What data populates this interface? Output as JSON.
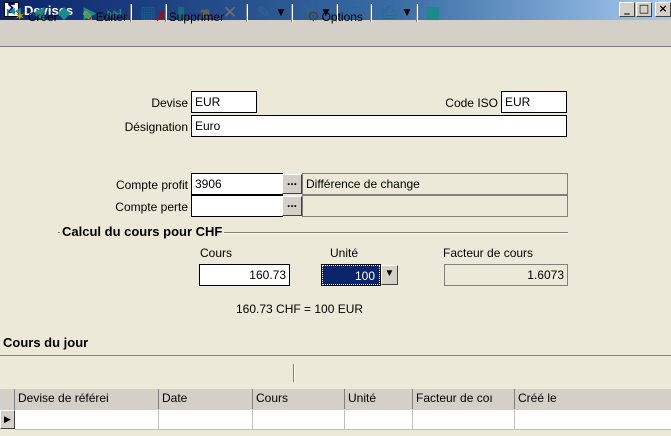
{
  "window": {
    "title": "Devises",
    "icon": "sigma-icon",
    "title_bar_color": "#0a246a"
  },
  "toolbar": {
    "icons": [
      "first-record-icon",
      "prev-record-icon",
      "diamond-icon",
      "next-record-icon",
      "last-record-icon",
      "grid-view-icon",
      "new-doc-icon",
      "save-icon",
      "delete-icon",
      "pencil-icon",
      "filter-icon",
      "cursor-icon",
      "print-icon",
      "exit-icon"
    ]
  },
  "form": {
    "devise_label": "Devise",
    "devise_value": "EUR",
    "code_iso_label": "Code ISO",
    "code_iso_value": "EUR",
    "designation_label": "Désignation",
    "designation_value": "Euro",
    "compte_profit_label": "Compte profit",
    "compte_profit_value": "3906",
    "compte_profit_desc": "Différence de change",
    "compte_perte_label": "Compte perte",
    "compte_perte_value": "",
    "ellipsis": "..."
  },
  "calcul": {
    "group_title": "Calcul du cours pour CHF",
    "cours_label": "Cours",
    "cours_value": "160.73",
    "unite_label": "Unité",
    "unite_value": "100",
    "facteur_label": "Facteur de cours",
    "facteur_value": "1.6073",
    "summary": "160.73 CHF = 100 EUR"
  },
  "cours_du_jour": {
    "title": "Cours du jour",
    "actions": {
      "creer": "Créer",
      "editer": "Editer",
      "supprimer": "Supprimer",
      "options": "Options"
    },
    "columns": [
      "Devise de référei",
      "Date",
      "Cours",
      "Unité",
      "Facteur de coı",
      "Créé le"
    ],
    "row_indicator": "▶"
  }
}
